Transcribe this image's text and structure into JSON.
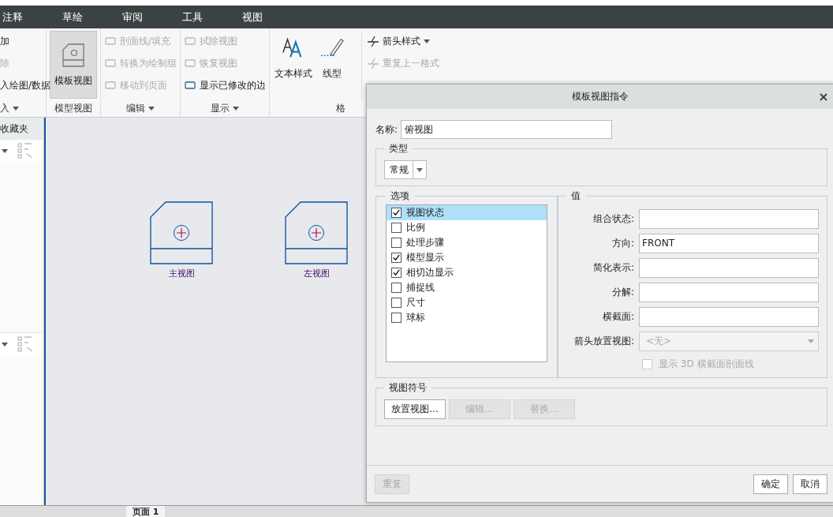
{
  "ribbon_tabs": [
    {
      "label": "注释"
    },
    {
      "label": "草绘"
    },
    {
      "label": "审阅"
    },
    {
      "label": "工具"
    },
    {
      "label": "视图"
    }
  ],
  "ribbon_groups": [
    {
      "kind": "list",
      "label": "入",
      "dropdown": true,
      "items": [
        {
          "label": "加",
          "disabled": false
        },
        {
          "label": "除",
          "disabled": true
        },
        {
          "label": "入绘图/数据",
          "disabled": false
        }
      ]
    },
    {
      "kind": "big",
      "label": "模型视图",
      "dropdown": false,
      "items": [
        {
          "label": "模板视图",
          "selected": true
        }
      ]
    },
    {
      "kind": "list",
      "label": "编辑",
      "dropdown": true,
      "items": [
        {
          "label": "剖面线/填充",
          "disabled": true
        },
        {
          "label": "转换为绘制组",
          "disabled": true
        },
        {
          "label": "移动到页面",
          "disabled": true
        }
      ]
    },
    {
      "kind": "list",
      "label": "显示",
      "dropdown": true,
      "items": [
        {
          "label": "拭除视图",
          "disabled": true
        },
        {
          "label": "恢复视图",
          "disabled": true
        },
        {
          "label": "显示已修改的边",
          "disabled": false
        }
      ]
    },
    {
      "kind": "format",
      "label": "格",
      "dropdown": false,
      "items": [
        {
          "label": "文本样式"
        },
        {
          "label": "线型"
        },
        {
          "label": "箭头样式",
          "disabled": false
        },
        {
          "label": "重复上一格式",
          "disabled": true
        }
      ]
    }
  ],
  "sidebar": {
    "title": "收藏夹"
  },
  "canvas": {
    "views": [
      {
        "label": "主视图"
      },
      {
        "label": "左视图"
      }
    ]
  },
  "page_tabs": [
    {
      "label": "页面 1"
    }
  ],
  "dialog": {
    "title": "模板视图指令",
    "name_label": "名称:",
    "name_value": "俯视图",
    "type_title": "类型",
    "type_value": "常规",
    "options_title": "选项",
    "options": [
      {
        "label": "视图状态",
        "checked": true,
        "selected": true
      },
      {
        "label": "比例",
        "checked": false,
        "selected": false
      },
      {
        "label": "处理步骤",
        "checked": false,
        "selected": false
      },
      {
        "label": "模型显示",
        "checked": true,
        "selected": false
      },
      {
        "label": "相切边显示",
        "checked": true,
        "selected": false
      },
      {
        "label": "捕捉线",
        "checked": false,
        "selected": false
      },
      {
        "label": "尺寸",
        "checked": false,
        "selected": false
      },
      {
        "label": "球标",
        "checked": false,
        "selected": false
      }
    ],
    "values_title": "值",
    "values": [
      {
        "kind": "field",
        "label": "组合状态:"
      },
      {
        "kind": "field",
        "label": "方向:",
        "value": "FRONT"
      },
      {
        "kind": "field",
        "label": "简化表示:"
      },
      {
        "kind": "field",
        "label": "分解:"
      },
      {
        "kind": "field",
        "label": "横截面:"
      },
      {
        "kind": "select",
        "label": "箭头放置视图:",
        "placeholder": "<无>",
        "disabled": true
      }
    ],
    "section_checkbox": {
      "label": "显示 3D 横截面剖面线",
      "checked": false,
      "disabled": true
    },
    "symbol_title": "视图符号",
    "symbol_buttons": [
      {
        "label": "放置视图...",
        "disabled": false
      },
      {
        "label": "编辑...",
        "disabled": true
      },
      {
        "label": "替换...",
        "disabled": true
      }
    ],
    "footer_buttons": [
      {
        "label": "重复",
        "disabled": true
      },
      {
        "label": "确定",
        "disabled": false
      },
      {
        "label": "取消",
        "disabled": false
      }
    ]
  }
}
